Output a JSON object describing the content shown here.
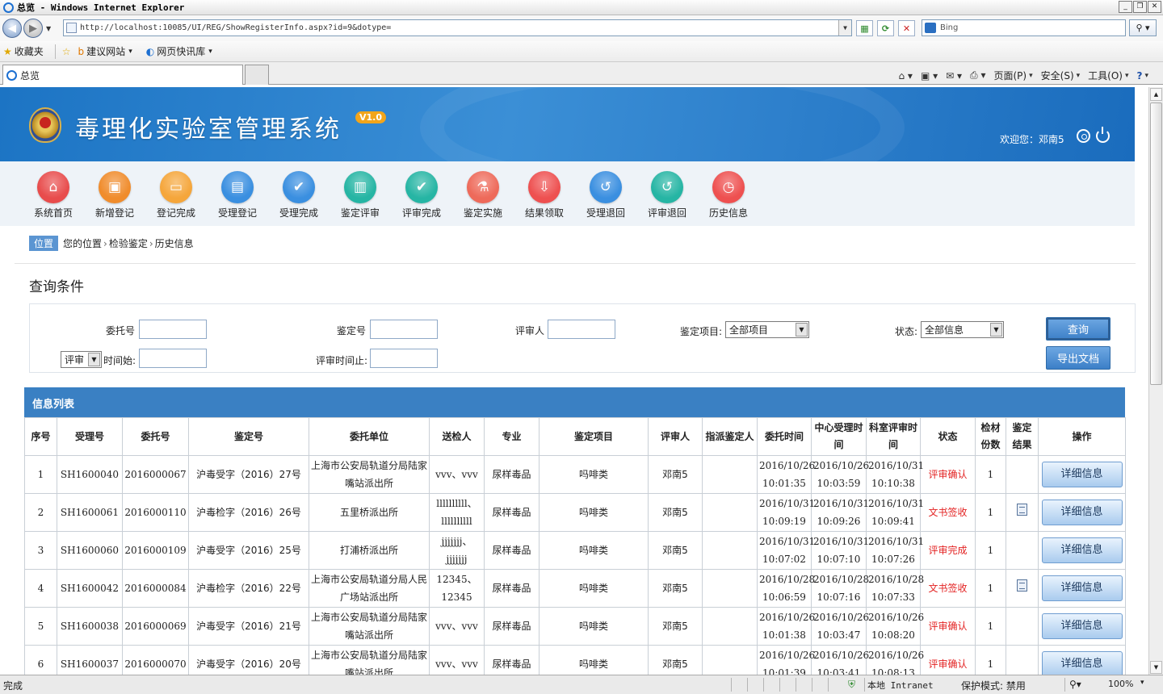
{
  "window": {
    "title": "总览 - Windows Internet Explorer"
  },
  "addr": {
    "url": "http://localhost:10085/UI/REG/ShowRegisterInfo.aspx?id=9&dotype=",
    "search_placeholder": "Bing"
  },
  "favbar": {
    "favorites": "收藏夹",
    "suggested": "建议网站",
    "webslice": "网页快讯库"
  },
  "tab": {
    "title": "总览"
  },
  "cmd": {
    "page": "页面(P)",
    "safety": "安全(S)",
    "tools": "工具(O)"
  },
  "app": {
    "title": "毒理化实验室管理系统",
    "version": "V1.0",
    "welcome": "欢迎您：邓南5"
  },
  "toolbar": [
    {
      "label": "系统首页",
      "color": "#e84c4c",
      "icon": "⌂"
    },
    {
      "label": "新增登记",
      "color": "#f08c2c",
      "icon": "▣"
    },
    {
      "label": "登记完成",
      "color": "#f5a63b",
      "icon": "▭"
    },
    {
      "label": "受理登记",
      "color": "#3a8fe0",
      "icon": "▤"
    },
    {
      "label": "受理完成",
      "color": "#3a8fe0",
      "icon": "✔"
    },
    {
      "label": "鉴定评审",
      "color": "#26b5a4",
      "icon": "▥"
    },
    {
      "label": "评审完成",
      "color": "#26b5a4",
      "icon": "✔"
    },
    {
      "label": "鉴定实施",
      "color": "#ee6a5a",
      "icon": "⚗"
    },
    {
      "label": "结果领取",
      "color": "#ee5050",
      "icon": "⇩"
    },
    {
      "label": "受理退回",
      "color": "#3a8fe0",
      "icon": "↺"
    },
    {
      "label": "评审退回",
      "color": "#26b5a4",
      "icon": "↺"
    },
    {
      "label": "历史信息",
      "color": "#ee5050",
      "icon": "◷"
    }
  ],
  "crumbs": {
    "tag": "位置",
    "path1": "您的位置",
    "sep": "›",
    "path2": "检验鉴定",
    "path3": "历史信息"
  },
  "query": {
    "title": "查询条件",
    "wtbh": "委托号",
    "jdh": "鉴定号",
    "psr": "评审人",
    "jdxm": "鉴定项目:",
    "jdxm_val": "全部项目",
    "zt": "状态:",
    "zt_val": "全部信息",
    "type_val": "评审",
    "time_start": "时间始:",
    "time_end": "评审时间止:",
    "btn_query": "查询",
    "btn_export": "导出文档"
  },
  "list": {
    "title": "信息列表",
    "headers": [
      "序号",
      "受理号",
      "委托号",
      "鉴定号",
      "委托单位",
      "送检人",
      "专业",
      "鉴定项目",
      "评审人",
      "指派鉴定人",
      "委托时间",
      "中心受理时间",
      "科室评审时间",
      "状态",
      "检材份数",
      "鉴定结果",
      "操作"
    ],
    "detail_label": "详细信息",
    "rows": [
      {
        "no": "1",
        "slh": "SH1600040",
        "wth": "2016000067",
        "jdh": "沪毒受字（2016）27号",
        "unit": "上海市公安局轨道分局陆家嘴站派出所",
        "sjr": "vvv、vvv",
        "zy": "尿样毒品",
        "xm": "吗啡类",
        "psr": "邓南5",
        "zp": "",
        "wt1": "2016/10/26",
        "wt2": "10:01:35",
        "sl1": "2016/10/26",
        "sl2": "10:03:59",
        "ps1": "2016/10/31",
        "ps2": "10:10:38",
        "zt": "评审确认",
        "fs": "1",
        "doc": false
      },
      {
        "no": "2",
        "slh": "SH1600061",
        "wth": "2016000110",
        "jdh": "沪毒检字（2016）26号",
        "unit": "五里桥派出所",
        "sjr": "llllllllll、llllllllll",
        "zy": "尿样毒品",
        "xm": "吗啡类",
        "psr": "邓南5",
        "zp": "",
        "wt1": "2016/10/31",
        "wt2": "10:09:19",
        "sl1": "2016/10/31",
        "sl2": "10:09:26",
        "ps1": "2016/10/31",
        "ps2": "10:09:41",
        "zt": "文书签收",
        "fs": "1",
        "doc": true
      },
      {
        "no": "3",
        "slh": "SH1600060",
        "wth": "2016000109",
        "jdh": "沪毒受字（2016）25号",
        "unit": "打浦桥派出所",
        "sjr": "jjjjjjj、jjjjjjj",
        "zy": "尿样毒品",
        "xm": "吗啡类",
        "psr": "邓南5",
        "zp": "",
        "wt1": "2016/10/31",
        "wt2": "10:07:02",
        "sl1": "2016/10/31",
        "sl2": "10:07:10",
        "ps1": "2016/10/31",
        "ps2": "10:07:26",
        "zt": "评审完成",
        "fs": "1",
        "doc": false
      },
      {
        "no": "4",
        "slh": "SH1600042",
        "wth": "2016000084",
        "jdh": "沪毒检字（2016）22号",
        "unit": "上海市公安局轨道分局人民广场站派出所",
        "sjr": "12345、12345",
        "zy": "尿样毒品",
        "xm": "吗啡类",
        "psr": "邓南5",
        "zp": "",
        "wt1": "2016/10/28",
        "wt2": "10:06:59",
        "sl1": "2016/10/28",
        "sl2": "10:07:16",
        "ps1": "2016/10/28",
        "ps2": "10:07:33",
        "zt": "文书签收",
        "fs": "1",
        "doc": true
      },
      {
        "no": "5",
        "slh": "SH1600038",
        "wth": "2016000069",
        "jdh": "沪毒受字（2016）21号",
        "unit": "上海市公安局轨道分局陆家嘴站派出所",
        "sjr": "vvv、vvv",
        "zy": "尿样毒品",
        "xm": "吗啡类",
        "psr": "邓南5",
        "zp": "",
        "wt1": "2016/10/26",
        "wt2": "10:01:38",
        "sl1": "2016/10/26",
        "sl2": "10:03:47",
        "ps1": "2016/10/26",
        "ps2": "10:08:20",
        "zt": "评审确认",
        "fs": "1",
        "doc": false
      },
      {
        "no": "6",
        "slh": "SH1600037",
        "wth": "2016000070",
        "jdh": "沪毒受字（2016）20号",
        "unit": "上海市公安局轨道分局陆家嘴站派出所",
        "sjr": "vvv、vvv",
        "zy": "尿样毒品",
        "xm": "吗啡类",
        "psr": "邓南5",
        "zp": "",
        "wt1": "2016/10/26",
        "wt2": "10:01:39",
        "sl1": "2016/10/26",
        "sl2": "10:03:41",
        "ps1": "2016/10/26",
        "ps2": "10:08:13",
        "zt": "评审确认",
        "fs": "1",
        "doc": false
      }
    ]
  },
  "status": {
    "done": "完成",
    "zone": "本地 Intranet",
    "protect": "保护模式: 禁用",
    "zoom": "100%"
  }
}
